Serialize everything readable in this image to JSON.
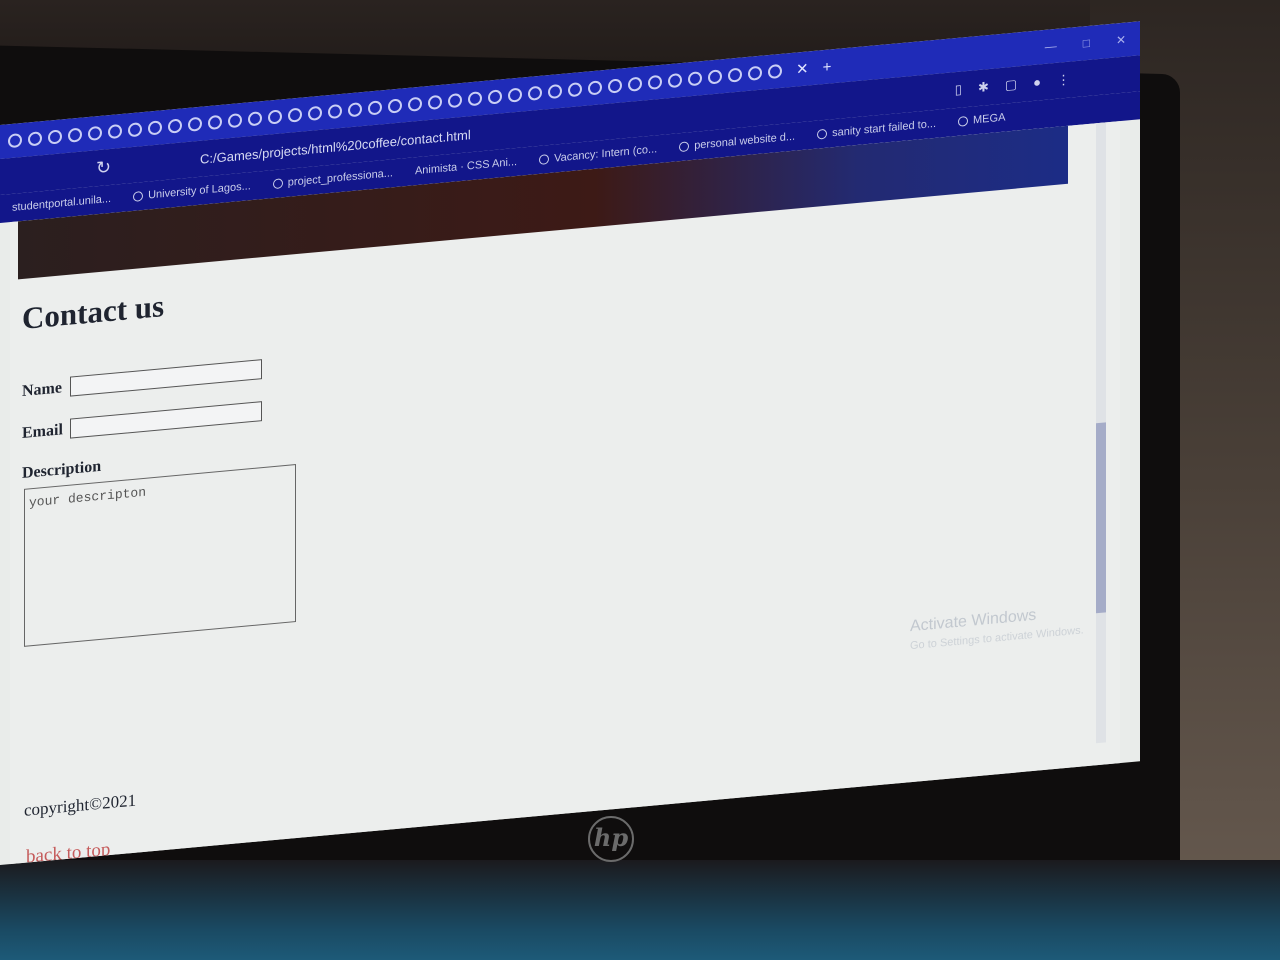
{
  "browser": {
    "address": "C:/Games/projects/html%20coffee/contact.html",
    "bookmarks": [
      {
        "label": "studentportal.unila..."
      },
      {
        "label": "University of Lagos..."
      },
      {
        "label": "project_professiona..."
      },
      {
        "label": "Animista · CSS Ani..."
      },
      {
        "label": "Vacancy: Intern (co..."
      },
      {
        "label": "personal website d..."
      },
      {
        "label": "sanity start failed to..."
      },
      {
        "label": "MEGA"
      }
    ]
  },
  "page": {
    "title": "Contact us",
    "form": {
      "name_label": "Name",
      "email_label": "Email",
      "description_label": "Description",
      "description_placeholder": "your descripton"
    },
    "footer": {
      "copyright": "copyright©2021",
      "back_to_top": "back to top"
    }
  },
  "watermark": {
    "title": "Activate Windows",
    "subtitle": "Go to Settings to activate Windows."
  },
  "device": {
    "logo": "hp"
  }
}
